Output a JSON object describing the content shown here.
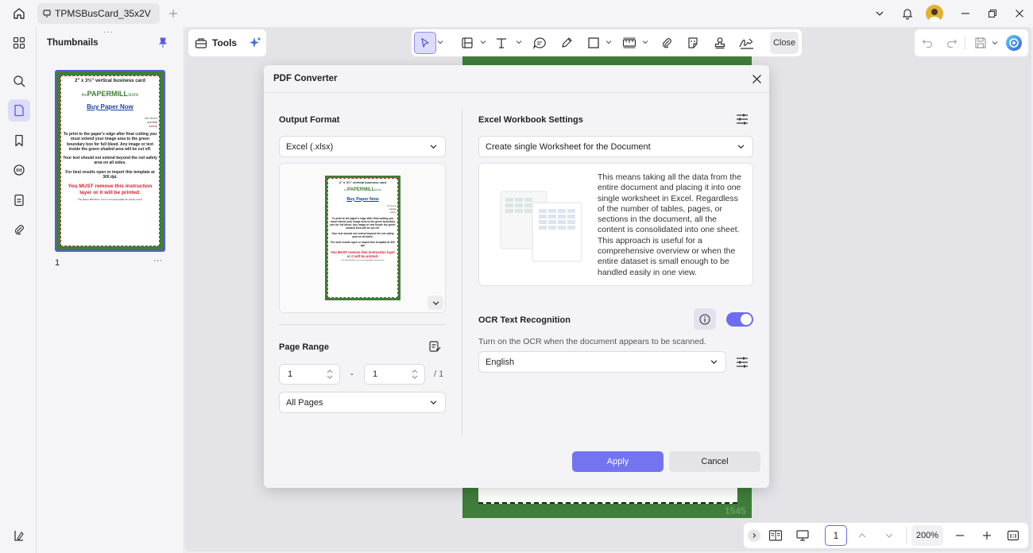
{
  "tab": {
    "title": "TPMSBusCard_35x2V"
  },
  "panel": {
    "title": "Thumbnails",
    "page_number": "1",
    "more": "···"
  },
  "toolbar": {
    "tools_label": "Tools",
    "close_label": "Close"
  },
  "document": {
    "heading": "2\" x 3½\" vertical business card",
    "brand_pre": "the",
    "brand_main": "PAPERMILL",
    "brand_post": "store",
    "link": "Buy Paper Now",
    "legend_full_bleed": "full bleed",
    "legend_cut_line": "cut line",
    "legend_safety": "safety",
    "para1": "To print to the paper's edge after final cutting you must extend your image area to the green boundary box for full bleed. Any image or text inside the green shaded area will be cut off.",
    "para2": "Your text should not extend beyond the red safety area on all sides.",
    "para3": "For best results open or import this template at 300 dpi.",
    "warning": "You MUST remove this instruction layer or it will be printed.",
    "footnote": "The Paper Mill Store .com is not responsible for printer errors",
    "corner_number": "1545"
  },
  "dialog": {
    "title": "PDF Converter",
    "output_format_label": "Output Format",
    "output_format_value": "Excel (.xlsx)",
    "page_range_label": "Page Range",
    "range_from": "1",
    "range_dash": "-",
    "range_to": "1",
    "range_total": "/ 1",
    "page_subset": "All Pages",
    "excel_settings_label": "Excel Workbook Settings",
    "worksheet_option": "Create single Worksheet for the Document",
    "worksheet_description": "This means taking all the data from the entire document and placing it into one single worksheet in Excel. Regardless of the number of tables, pages, or sections in the document, all the content is consolidated into one sheet. This approach is useful for a comprehensive overview or when the entire dataset is small enough to be handled easily in one view.",
    "ocr_label": "OCR Text Recognition",
    "ocr_enabled": true,
    "ocr_hint": "Turn on the OCR when the document appears to be scanned.",
    "ocr_language": "English",
    "apply_label": "Apply",
    "cancel_label": "Cancel"
  },
  "statusbar": {
    "page": "1",
    "zoom": "200%"
  },
  "colors": {
    "accent": "#6c6cf0",
    "card_green": "#3f7d3a",
    "warning_red": "#d0202a",
    "link_blue": "#1a44a8"
  }
}
